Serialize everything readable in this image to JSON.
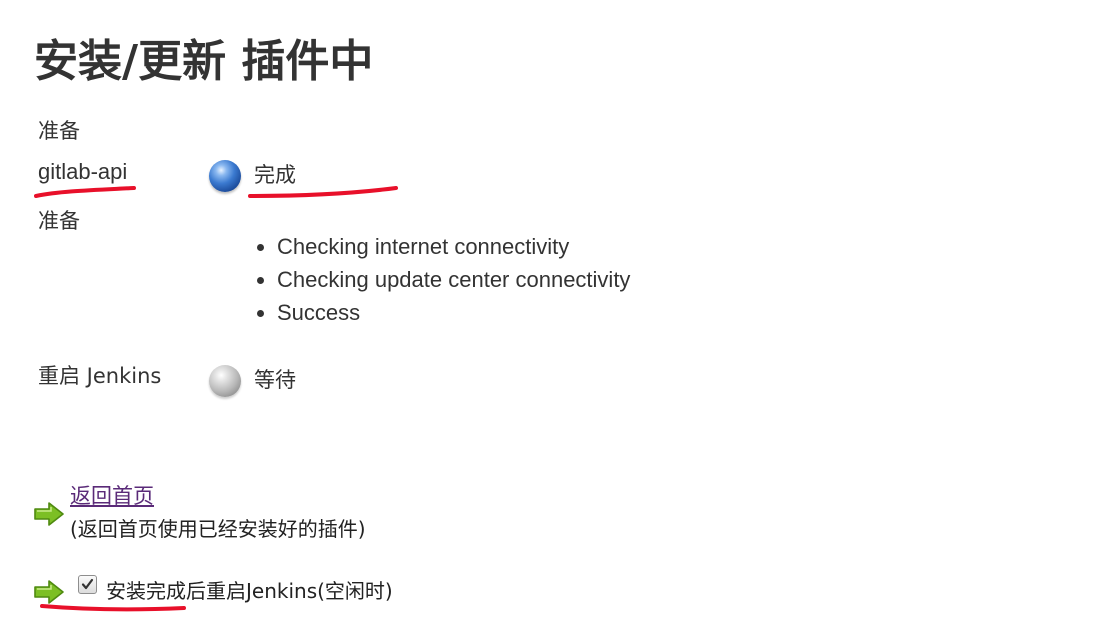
{
  "page": {
    "title": "安装/更新 插件中"
  },
  "rows": {
    "prepare_1": "准备",
    "plugin_name": "gitlab-api",
    "plugin_status": "完成",
    "prepare_2": "准备",
    "restart_name": "重启 Jenkins",
    "restart_status": "等待"
  },
  "checks": [
    "Checking internet connectivity",
    "Checking update center connectivity",
    "Success"
  ],
  "actions": {
    "back_home_label": "返回首页",
    "back_home_note": "(返回首页使用已经安装好的插件)",
    "restart_checkbox_label": "安装完成后重启Jenkins(空闲时)",
    "restart_checkbox_checked": true
  },
  "colors": {
    "status_done": "#3b7ad0",
    "status_pending": "#b8b8b8",
    "arrow": "#6fae1e",
    "annotation": "#e8102a",
    "link": "#5a2a78"
  },
  "icons": {
    "status_done": "blue-ball-icon",
    "status_pending": "grey-ball-icon",
    "action": "green-arrow-icon"
  }
}
